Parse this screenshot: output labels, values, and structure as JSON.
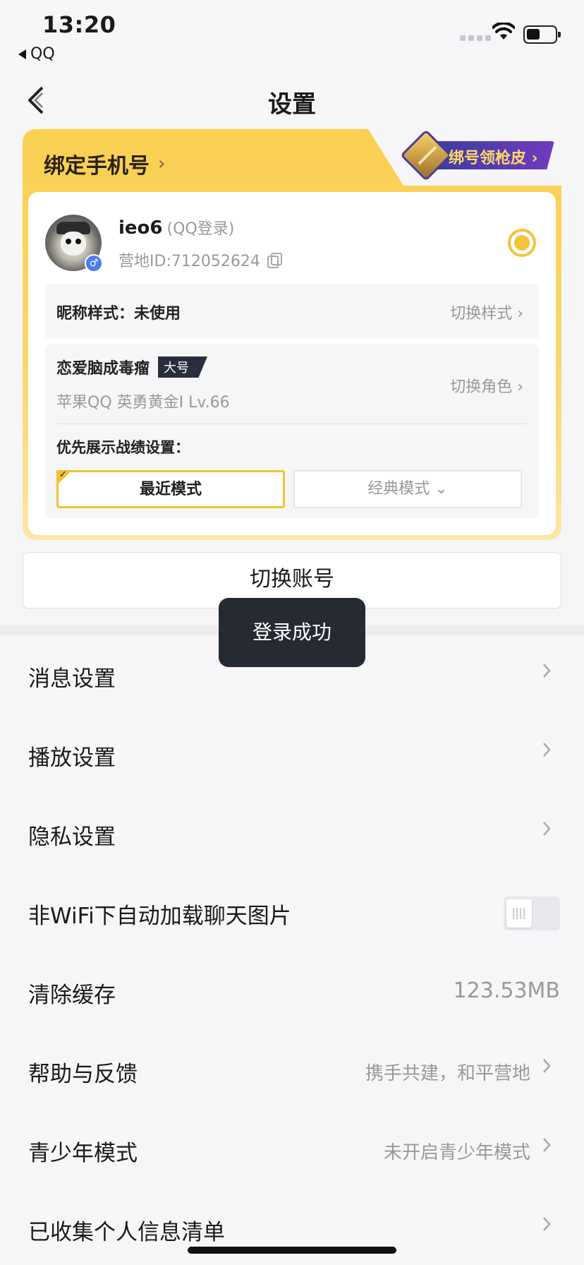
{
  "status_bar": {
    "time": "13:20",
    "back_app": "QQ"
  },
  "nav": {
    "title": "设置"
  },
  "account_card": {
    "bind_phone": "绑定手机号",
    "promo_label": "绑号领枪皮",
    "username": "ieo6",
    "login_type": "(QQ登录)",
    "camp_id": "营地ID:712052624",
    "nickname_style": "昵称样式：未使用",
    "switch_style": "切换样式",
    "role_name": "恋爱脑成毒瘤",
    "role_tag": "大号",
    "role_info": "苹果QQ  英勇黄金I  Lv.66",
    "switch_role": "切换角色",
    "pref_label": "优先展示战绩设置：",
    "mode_recent": "最近模式",
    "mode_classic": "经典模式"
  },
  "switch_account": "切换账号",
  "toast": "登录成功",
  "settings": [
    {
      "label": "消息设置"
    },
    {
      "label": "播放设置"
    },
    {
      "label": "隐私设置"
    },
    {
      "label": "非WiFi下自动加载聊天图片",
      "toggle": false
    },
    {
      "label": "清除缓存",
      "value": "123.53MB"
    },
    {
      "label": "帮助与反馈",
      "value": "携手共建，和平营地"
    },
    {
      "label": "青少年模式",
      "value": "未开启青少年模式"
    },
    {
      "label": "已收集个人信息清单"
    }
  ],
  "colors": {
    "accent_yellow": "#f5c33a",
    "toast_bg": "#252a33",
    "page_bg": "#f6f6f8"
  }
}
